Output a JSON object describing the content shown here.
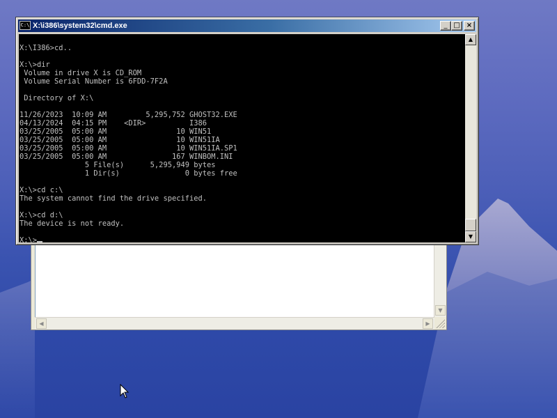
{
  "window": {
    "title": "X:\\i386\\system32\\cmd.exe",
    "icon_text": "C:\\",
    "buttons": {
      "minimize": "_",
      "maximize": "□",
      "close": "×"
    }
  },
  "console": {
    "lines": [
      "",
      "X:\\I386>cd..",
      "",
      "X:\\>dir",
      " Volume in drive X is CD_ROM",
      " Volume Serial Number is 6FDD-7F2A",
      "",
      " Directory of X:\\",
      "",
      "11/26/2023  10:09 AM         5,295,752 GHOST32.EXE",
      "04/13/2024  04:15 PM    <DIR>          I386",
      "03/25/2005  05:00 AM                10 WIN51",
      "03/25/2005  05:00 AM                10 WIN51IA",
      "03/25/2005  05:00 AM                10 WIN51IA.SP1",
      "03/25/2005  05:00 AM               167 WINBOM.INI",
      "               5 File(s)      5,295,949 bytes",
      "               1 Dir(s)               0 bytes free",
      "",
      "X:\\>cd c:\\",
      "The system cannot find the drive specified.",
      "",
      "X:\\>cd d:\\",
      "The device is not ready.",
      ""
    ],
    "prompt": "X:\\>"
  },
  "icons": {
    "scroll_up": "arrow-up-icon",
    "scroll_down": "arrow-down-icon",
    "scroll_left": "arrow-left-icon",
    "scroll_right": "arrow-right-icon",
    "pointer": "mouse-pointer-icon"
  },
  "colors": {
    "console_bg": "#000000",
    "console_fg": "#c0c0c0",
    "title_active": "#0a246a",
    "desktop": "#3a53b0"
  }
}
